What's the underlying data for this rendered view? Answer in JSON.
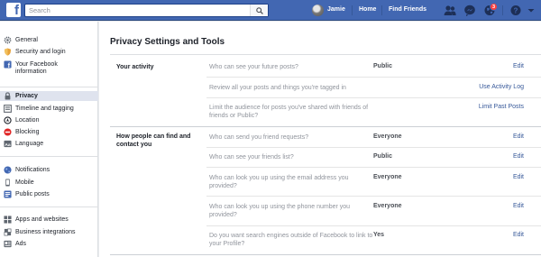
{
  "topbar": {
    "search_placeholder": "Search",
    "user_name": "Jamie",
    "home_label": "Home",
    "find_friends_label": "Find Friends",
    "notification_count": "3",
    "logo_letter": "f",
    "brand_color": "#4267b2"
  },
  "sidebar": {
    "items": [
      {
        "label": "General",
        "icon": "gear-icon"
      },
      {
        "label": "Security and login",
        "icon": "shield-icon"
      },
      {
        "label": "Your Facebook information",
        "icon": "facebook-icon"
      },
      {
        "label": "Privacy",
        "icon": "lock-icon"
      },
      {
        "label": "Timeline and tagging",
        "icon": "timeline-icon"
      },
      {
        "label": "Location",
        "icon": "location-icon"
      },
      {
        "label": "Blocking",
        "icon": "blocking-icon"
      },
      {
        "label": "Language",
        "icon": "language-icon"
      },
      {
        "label": "Notifications",
        "icon": "globe-icon"
      },
      {
        "label": "Mobile",
        "icon": "mobile-icon"
      },
      {
        "label": "Public posts",
        "icon": "public-posts-icon"
      },
      {
        "label": "Apps and websites",
        "icon": "apps-icon"
      },
      {
        "label": "Business integrations",
        "icon": "business-icon"
      },
      {
        "label": "Ads",
        "icon": "ads-icon"
      }
    ]
  },
  "main": {
    "title": "Privacy Settings and Tools",
    "sections": [
      {
        "label": "Your activity",
        "rows": [
          {
            "question": "Who can see your future posts?",
            "value": "Public",
            "action": "Edit"
          },
          {
            "question": "Review all your posts and things you're tagged in",
            "value": "",
            "action": "Use Activity Log"
          },
          {
            "question": "Limit the audience for posts you've shared with friends of friends or Public?",
            "value": "",
            "action": "Limit Past Posts"
          }
        ]
      },
      {
        "label": "How people can find and contact you",
        "rows": [
          {
            "question": "Who can send you friend requests?",
            "value": "Everyone",
            "action": "Edit"
          },
          {
            "question": "Who can see your friends list?",
            "value": "Public",
            "action": "Edit"
          },
          {
            "question": "Who can look you up using the email address you provided?",
            "value": "Everyone",
            "action": "Edit"
          },
          {
            "question": "Who can look you up using the phone number you provided?",
            "value": "Everyone",
            "action": "Edit"
          },
          {
            "question": "Do you want search engines outside of Facebook to link to your Profile?",
            "value": "Yes",
            "action": "Edit"
          }
        ]
      }
    ]
  }
}
